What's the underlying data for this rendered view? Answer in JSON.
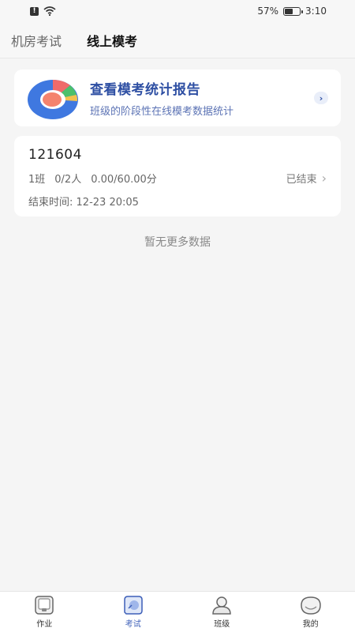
{
  "status_bar": {
    "battery": "57%",
    "time": "3:10",
    "alert_glyph": "!"
  },
  "top_tabs": [
    {
      "label": "机房考试",
      "active": false
    },
    {
      "label": "线上模考",
      "active": true
    }
  ],
  "report_card": {
    "title": "查看模考统计报告",
    "subtitle": "班级的阶段性在线模考数据统计",
    "arrow": "›"
  },
  "exam": {
    "name": "121604",
    "class_name": "1班",
    "count": "0/2人",
    "score": "0.00/60.00分",
    "status": "已结束",
    "status_arrow": "›",
    "end_time_label": "结束时间:",
    "end_time": "12-23 20:05"
  },
  "no_more_text": "暂无更多数据",
  "bottom_nav": [
    {
      "label": "作业",
      "icon": "homework-icon"
    },
    {
      "label": "考试",
      "icon": "exam-icon"
    },
    {
      "label": "班级",
      "icon": "class-icon"
    },
    {
      "label": "我的",
      "icon": "profile-icon"
    }
  ],
  "colors": {
    "accent": "#3d5fb8",
    "report_title": "#2e4fa3"
  }
}
